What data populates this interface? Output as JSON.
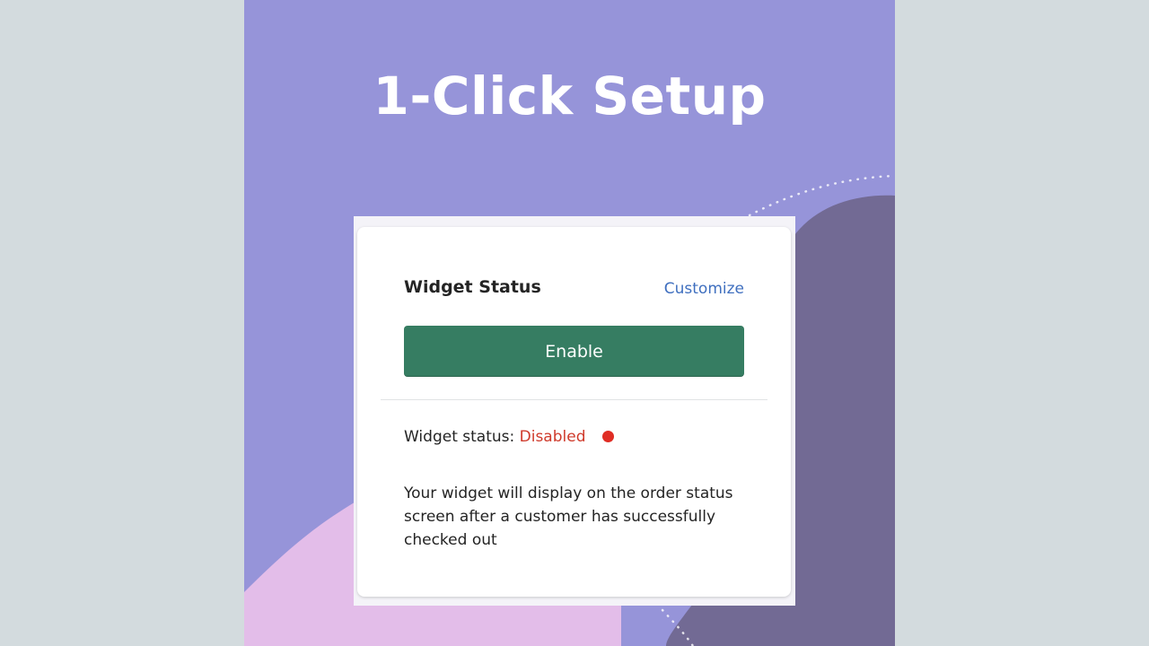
{
  "hero": {
    "title": "1-Click Setup"
  },
  "widget_card": {
    "title": "Widget Status",
    "customize_label": "Customize",
    "enable_label": "Enable",
    "status_label": "Widget status:",
    "status_value": "Disabled",
    "description": "Your widget will display on the order status screen after a customer has successfully checked out"
  },
  "colors": {
    "background_purple": "#9694d9",
    "dark_blob": "#726a94",
    "pink_blob": "#e3bde9",
    "enable_button": "#367d62",
    "link": "#3f6fbf",
    "status_disabled": "#cf3a2b",
    "status_dot": "#e02d24"
  },
  "icons": {
    "status_indicator": "red-dot-icon"
  }
}
